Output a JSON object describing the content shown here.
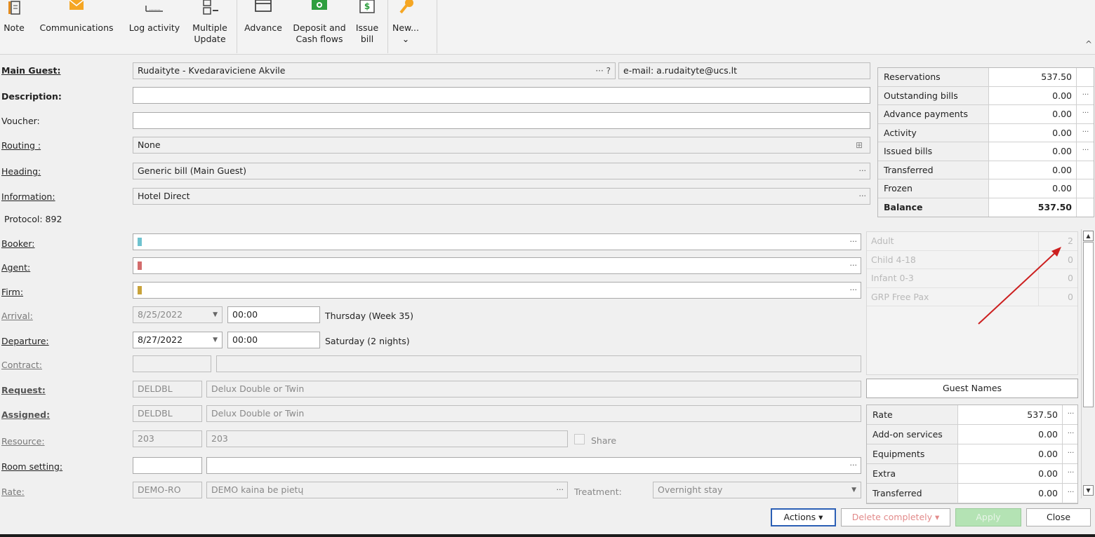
{
  "ribbon": {
    "note": "Note",
    "communications": "Communications",
    "log_activity": "Log activity",
    "multiple_update": "Multiple\nUpdate",
    "advance": "Advance",
    "deposit": "Deposit and\nCash flows",
    "issue_bill": "Issue\nbill",
    "new": "New...\n⌄",
    "collapse": "^"
  },
  "form": {
    "main_guest_label": "Main Guest:",
    "main_guest": "Rudaityte - Kvedaraviciene Akvile",
    "main_guest_help": "··· ?",
    "email": "e-mail: a.rudaityte@ucs.lt",
    "description_label": "Description:",
    "description": "",
    "voucher_label": "Voucher:",
    "voucher": "",
    "routing_label": "Routing :",
    "routing": "None",
    "heading_label": "Heading:",
    "heading": "Generic bill (Main Guest)",
    "information_label": "Information:",
    "information": "Hotel Direct",
    "protocol": "Protocol: 892",
    "booker_label": "Booker:",
    "agent_label": "Agent:",
    "firm_label": "Firm:",
    "arrival_label": "Arrival:",
    "arrival_date": "8/25/2022",
    "arrival_time": "00:00",
    "arrival_day": "Thursday (Week 35)",
    "departure_label": "Departure:",
    "departure_date": "8/27/2022",
    "departure_time": "00:00",
    "departure_day": "Saturday (2 nights)",
    "contract_label": "Contract:",
    "request_label": "Request:",
    "request_code": "DELDBL",
    "request_name": "Delux Double or Twin",
    "assigned_label": "Assigned:",
    "assigned_code": "DELDBL",
    "assigned_name": "Delux Double or Twin",
    "resource_label": "Resource:",
    "resource_code": "203",
    "resource_name": "203",
    "share_label": "Share",
    "room_setting_label": "Room setting:",
    "rate_label": "Rate:",
    "rate_code": "DEMO-RO",
    "rate_name": "DEMO kaina be pietų",
    "treatment_label": "Treatment:",
    "treatment": "Overnight stay"
  },
  "summary": [
    {
      "label": "Reservations",
      "value": "537.50",
      "dots": ""
    },
    {
      "label": "Outstanding bills",
      "value": "0.00",
      "dots": "···"
    },
    {
      "label": "Advance payments",
      "value": "0.00",
      "dots": "···"
    },
    {
      "label": "Activity",
      "value": "0.00",
      "dots": "···"
    },
    {
      "label": "Issued bills",
      "value": "0.00",
      "dots": "···"
    },
    {
      "label": "Transferred",
      "value": "0.00",
      "dots": ""
    },
    {
      "label": "Frozen",
      "value": "0.00",
      "dots": ""
    },
    {
      "label": "Balance",
      "value": "537.50",
      "dots": ""
    }
  ],
  "occupancy": [
    {
      "label": "Adult",
      "value": "2"
    },
    {
      "label": "Child 4-18",
      "value": "0"
    },
    {
      "label": "Infant 0-3",
      "value": "0"
    },
    {
      "label": "GRP Free Pax",
      "value": "0"
    }
  ],
  "guest_names": "Guest Names",
  "rates": [
    {
      "label": "Rate",
      "value": "537.50"
    },
    {
      "label": "Add-on services",
      "value": "0.00"
    },
    {
      "label": "Equipments",
      "value": "0.00"
    },
    {
      "label": "Extra",
      "value": "0.00"
    },
    {
      "label": "Transferred",
      "value": "0.00"
    }
  ],
  "buttons": {
    "actions": "Actions  ▾",
    "delete": "Delete completely  ▾",
    "apply": "Apply",
    "close": "Close"
  },
  "colors": {
    "booker": "#6fc3cf",
    "agent": "#d36c6c",
    "firm": "#c9a33a",
    "arrow": "#cc1f1f"
  }
}
